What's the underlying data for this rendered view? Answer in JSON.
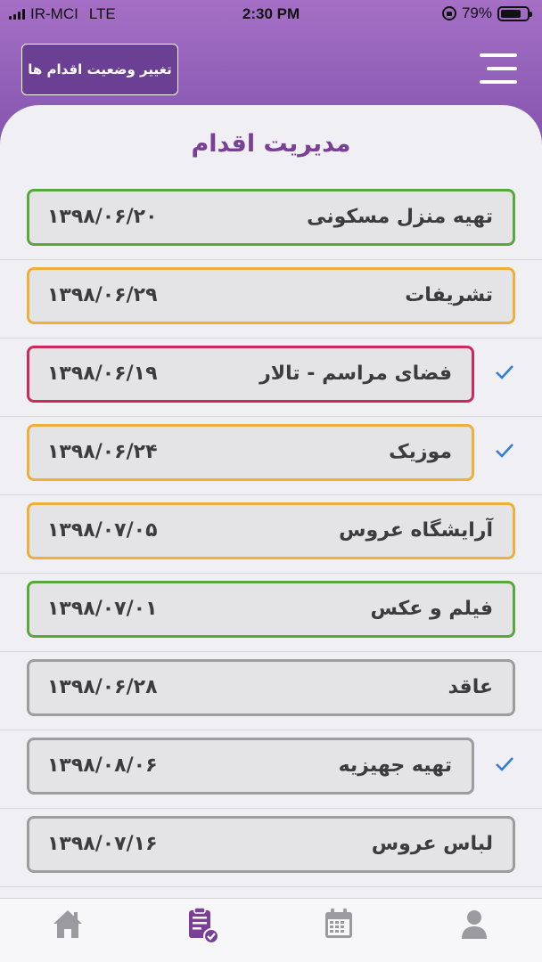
{
  "status_bar": {
    "carrier": "IR-MCI",
    "network": "LTE",
    "time": "2:30 PM",
    "battery_percent_label": "79%",
    "battery_level": 0.79
  },
  "header": {
    "action_button_label": "تغییر وضعیت اقدام ها",
    "menu_icon": "hamburger-menu-icon"
  },
  "page": {
    "title": "مدیریت اقدام"
  },
  "colors": {
    "accent": "#7a3f96",
    "header": "#9a66c0",
    "status_green": "#5aa83c",
    "status_orange": "#eeb03a",
    "status_red": "#cc2a5a",
    "status_gray": "#9d9d9d",
    "check": "#2f7fd8"
  },
  "tasks": [
    {
      "name": "تهیه منزل مسکونی",
      "date": "۱۳۹۸/۰۶/۲۰",
      "status": "green",
      "checked": false
    },
    {
      "name": "تشریفات",
      "date": "۱۳۹۸/۰۶/۲۹",
      "status": "orange",
      "checked": false
    },
    {
      "name": "فضای مراسم - تالار",
      "date": "۱۳۹۸/۰۶/۱۹",
      "status": "red",
      "checked": true
    },
    {
      "name": "موزیک",
      "date": "۱۳۹۸/۰۶/۲۴",
      "status": "orange",
      "checked": true
    },
    {
      "name": "آرایشگاه عروس",
      "date": "۱۳۹۸/۰۷/۰۵",
      "status": "orange",
      "checked": false
    },
    {
      "name": "فیلم و عکس",
      "date": "۱۳۹۸/۰۷/۰۱",
      "status": "green",
      "checked": false
    },
    {
      "name": "عاقد",
      "date": "۱۳۹۸/۰۶/۲۸",
      "status": "gray",
      "checked": false
    },
    {
      "name": "تهیه جهیزیه",
      "date": "۱۳۹۸/۰۸/۰۶",
      "status": "gray",
      "checked": true
    },
    {
      "name": "لباس عروس",
      "date": "۱۳۹۸/۰۷/۱۶",
      "status": "gray",
      "checked": false
    }
  ],
  "tab_bar": {
    "active_index": 1,
    "tabs": [
      {
        "icon": "home-icon"
      },
      {
        "icon": "clipboard-check-icon"
      },
      {
        "icon": "calendar-icon"
      },
      {
        "icon": "profile-icon"
      }
    ]
  }
}
